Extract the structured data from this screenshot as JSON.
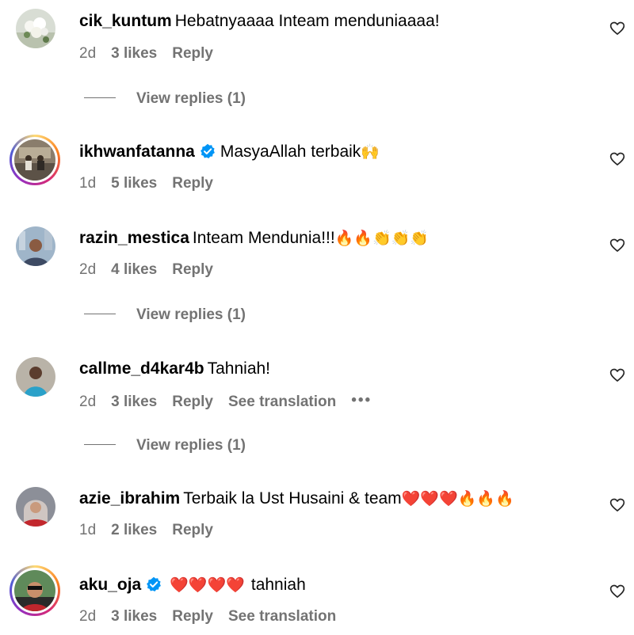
{
  "comments": [
    {
      "username": "cik_kuntum",
      "verified": false,
      "text": "Hebatnyaaaa Inteam menduniaaaa!",
      "emoji": "",
      "time": "2d",
      "likes": "3 likes",
      "reply": "Reply",
      "view_replies": "View replies (1)"
    },
    {
      "username": "ikhwanfatanna",
      "verified": true,
      "text": "MasyaAllah terbaik",
      "emoji": "🙌",
      "time": "1d",
      "likes": "5 likes",
      "reply": "Reply"
    },
    {
      "username": "razin_mestica",
      "verified": false,
      "text": "Inteam Mendunia!!!",
      "emoji": "🔥🔥👏👏👏",
      "time": "2d",
      "likes": "4 likes",
      "reply": "Reply",
      "view_replies": "View replies (1)"
    },
    {
      "username": "callme_d4kar4b",
      "verified": false,
      "text": "Tahniah!",
      "emoji": "",
      "time": "2d",
      "likes": "3 likes",
      "reply": "Reply",
      "see_translation": "See translation",
      "more": "•••",
      "view_replies": "View replies (1)"
    },
    {
      "username": "azie_ibrahim",
      "verified": false,
      "text": "Terbaik la Ust Husaini & team",
      "emoji": "❤️❤️❤️🔥🔥🔥",
      "time": "1d",
      "likes": "2 likes",
      "reply": "Reply"
    },
    {
      "username": "aku_oja",
      "verified": true,
      "text": "tahniah",
      "emoji": "❤️❤️❤️❤️",
      "time": "2d",
      "likes": "3 likes",
      "reply": "Reply",
      "see_translation": "See translation"
    }
  ],
  "colors": {
    "secondary_text": "#737373",
    "verified_blue": "#0095f6",
    "heart_stroke": "#262626"
  },
  "icons": {
    "like": "heart-outline-icon",
    "verified": "verified-badge-icon",
    "more": "more-horizontal-icon"
  }
}
